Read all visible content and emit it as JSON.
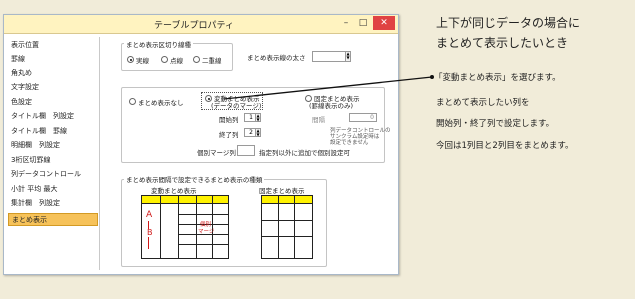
{
  "window": {
    "title": "テーブルプロパティ"
  },
  "sidebar": {
    "items": [
      {
        "label": "表示位置"
      },
      {
        "label": "罫線"
      },
      {
        "label": "角丸め"
      },
      {
        "label": "文字設定"
      },
      {
        "label": "色設定"
      },
      {
        "label": "タイトル欄　列設定"
      },
      {
        "label": "タイトル欄　罫線"
      },
      {
        "label": "明細欄　列設定"
      },
      {
        "label": "3桁区切罫線"
      },
      {
        "label": "列データコントロール"
      },
      {
        "label": "小計 平均 最大"
      },
      {
        "label": "集計欄　列設定"
      },
      {
        "label": "まとめ表示"
      }
    ],
    "selected_index": 12
  },
  "line_group": {
    "title": "まとめ表示区切り線種",
    "options": [
      "実線",
      "点線",
      "二重線"
    ],
    "selected": "実線",
    "thickness_label": "まとめ表示線の太さ",
    "thickness_value": ""
  },
  "mode_group": {
    "none_label": "まとめ表示なし",
    "variable_label_1": "変動まとめ表示",
    "variable_label_2": "(データのマージ)",
    "fixed_label_1": "固定まとめ表示",
    "fixed_label_2": "(罫線表示のみ)",
    "start_col_label": "開始列",
    "start_col_value": "1",
    "end_col_label": "終了列",
    "end_col_value": "2",
    "interval_label": "間隔",
    "interval_value": "0",
    "note_1": "列データコントロールの",
    "note_2": "サンクラム設定時は",
    "note_3": "設定できません",
    "individual_label": "個別マージ列",
    "individual_value": "",
    "individual_note": "指定列以外に追加で個別設定可"
  },
  "example_group": {
    "title": "まとめ表示間隔で設定できるまとめ表示の種類",
    "variable_caption": "変動まとめ表示",
    "fixed_caption": "固定まとめ表示",
    "label_a": "A",
    "label_b": "B",
    "merge_label_1": "個別",
    "merge_label_2": "マージ"
  },
  "annotations": {
    "heading_line_1": "上下が同じデータの場合に",
    "heading_line_2": "まとめて表示したいとき",
    "bullet": "「変動まとめ表示」を選びます。",
    "line_2": "まとめて表示したい列を",
    "line_3": "開始列・終了列で設定します。",
    "line_4": "今回は1列目と2列目をまとめます。"
  },
  "colors": {
    "background": "#f1ecd9",
    "titlebar": "#fff3c0",
    "selected_item": "#f6c25a",
    "header_yellow": "#fff200",
    "annotation_red": "#d01818"
  }
}
